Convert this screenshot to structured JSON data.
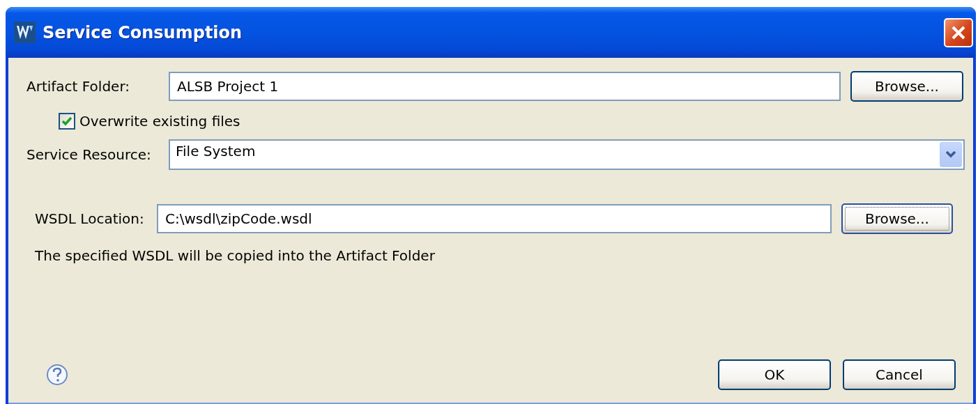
{
  "window": {
    "title": "Service Consumption"
  },
  "artifact_folder": {
    "label": "Artifact Folder:",
    "value": "ALSB Project 1",
    "button": "Browse..."
  },
  "overwrite": {
    "label": "Overwrite existing files",
    "checked": true
  },
  "service_resource": {
    "label": "Service Resource:",
    "value": "File System"
  },
  "wsdl_location": {
    "label": "WSDL Location:",
    "value": "C:\\wsdl\\zipCode.wsdl",
    "button": "Browse...",
    "focused": true
  },
  "note": "The specified WSDL will be copied into the Artifact Folder",
  "buttons": [
    "OK",
    "Cancel"
  ]
}
